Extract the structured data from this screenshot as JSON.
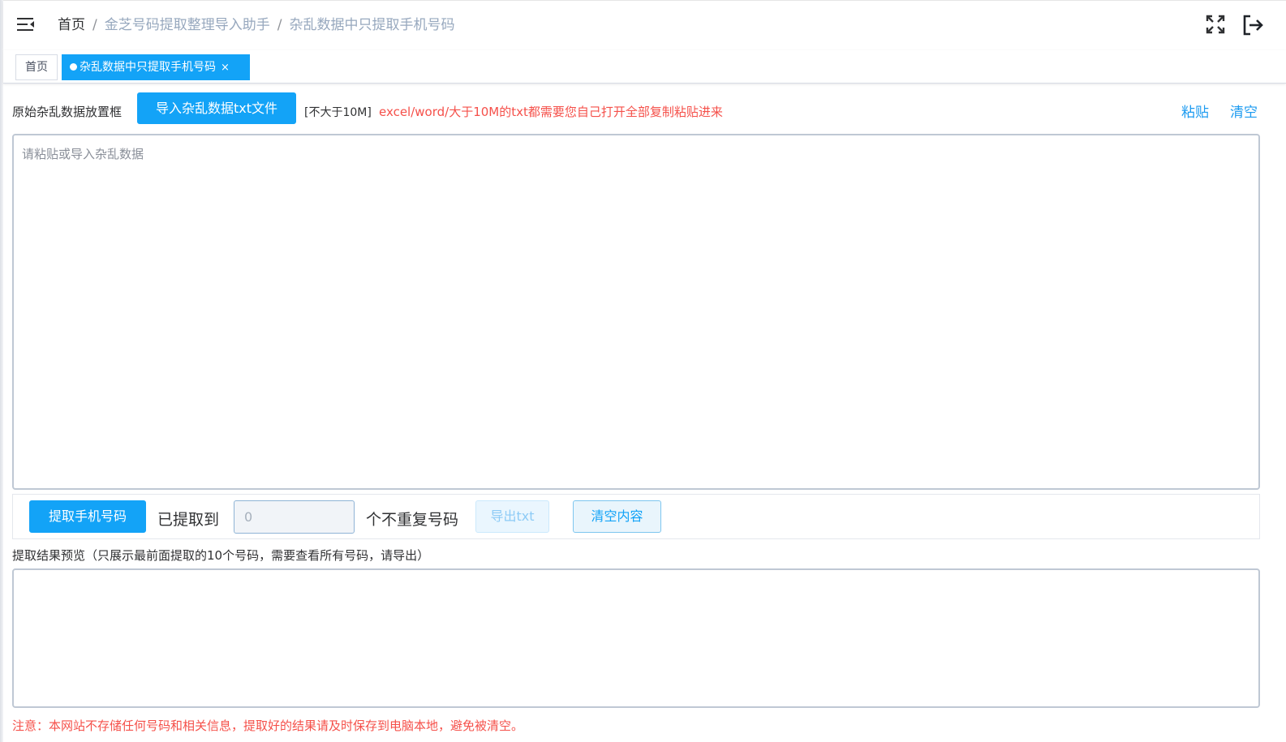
{
  "header": {
    "breadcrumb": {
      "home": "首页",
      "level1": "金芝号码提取整理导入助手",
      "level2": "杂乱数据中只提取手机号码",
      "separator": "/"
    },
    "icons": {
      "menu": "hamburger-icon",
      "fullscreen": "fullscreen-icon",
      "logout": "logout-icon"
    }
  },
  "tags": {
    "home": "首页",
    "active": "杂乱数据中只提取手机号码",
    "close_glyph": "×"
  },
  "toolbar": {
    "raw_label": "原始杂乱数据放置框",
    "import_button": "导入杂乱数据txt文件",
    "size_note": "[不大于10M]",
    "warning": "excel/word/大于10M的txt都需要您自己打开全部复制粘贴进来",
    "paste_link": "粘贴",
    "clear_link": "清空"
  },
  "raw_input": {
    "placeholder": "请粘贴或导入杂乱数据",
    "value": ""
  },
  "actions": {
    "extract_button": "提取手机号码",
    "got_label": "已提取到",
    "count_value": "0",
    "unique_label": "个不重复号码",
    "export_button": "导出txt",
    "clear_content_button": "清空内容"
  },
  "preview": {
    "label": "提取结果预览（只展示最前面提取的10个号码，需要查看所有号码，请导出）",
    "value": ""
  },
  "notice": "注意：本网站不存储任何号码和相关信息，提取好的结果请及时保存到电脑本地，避免被清空。",
  "colors": {
    "primary": "#13a3f7",
    "link": "#1d9bf0",
    "warning": "#f5504a",
    "breadcrumb_muted": "#97a8be"
  }
}
